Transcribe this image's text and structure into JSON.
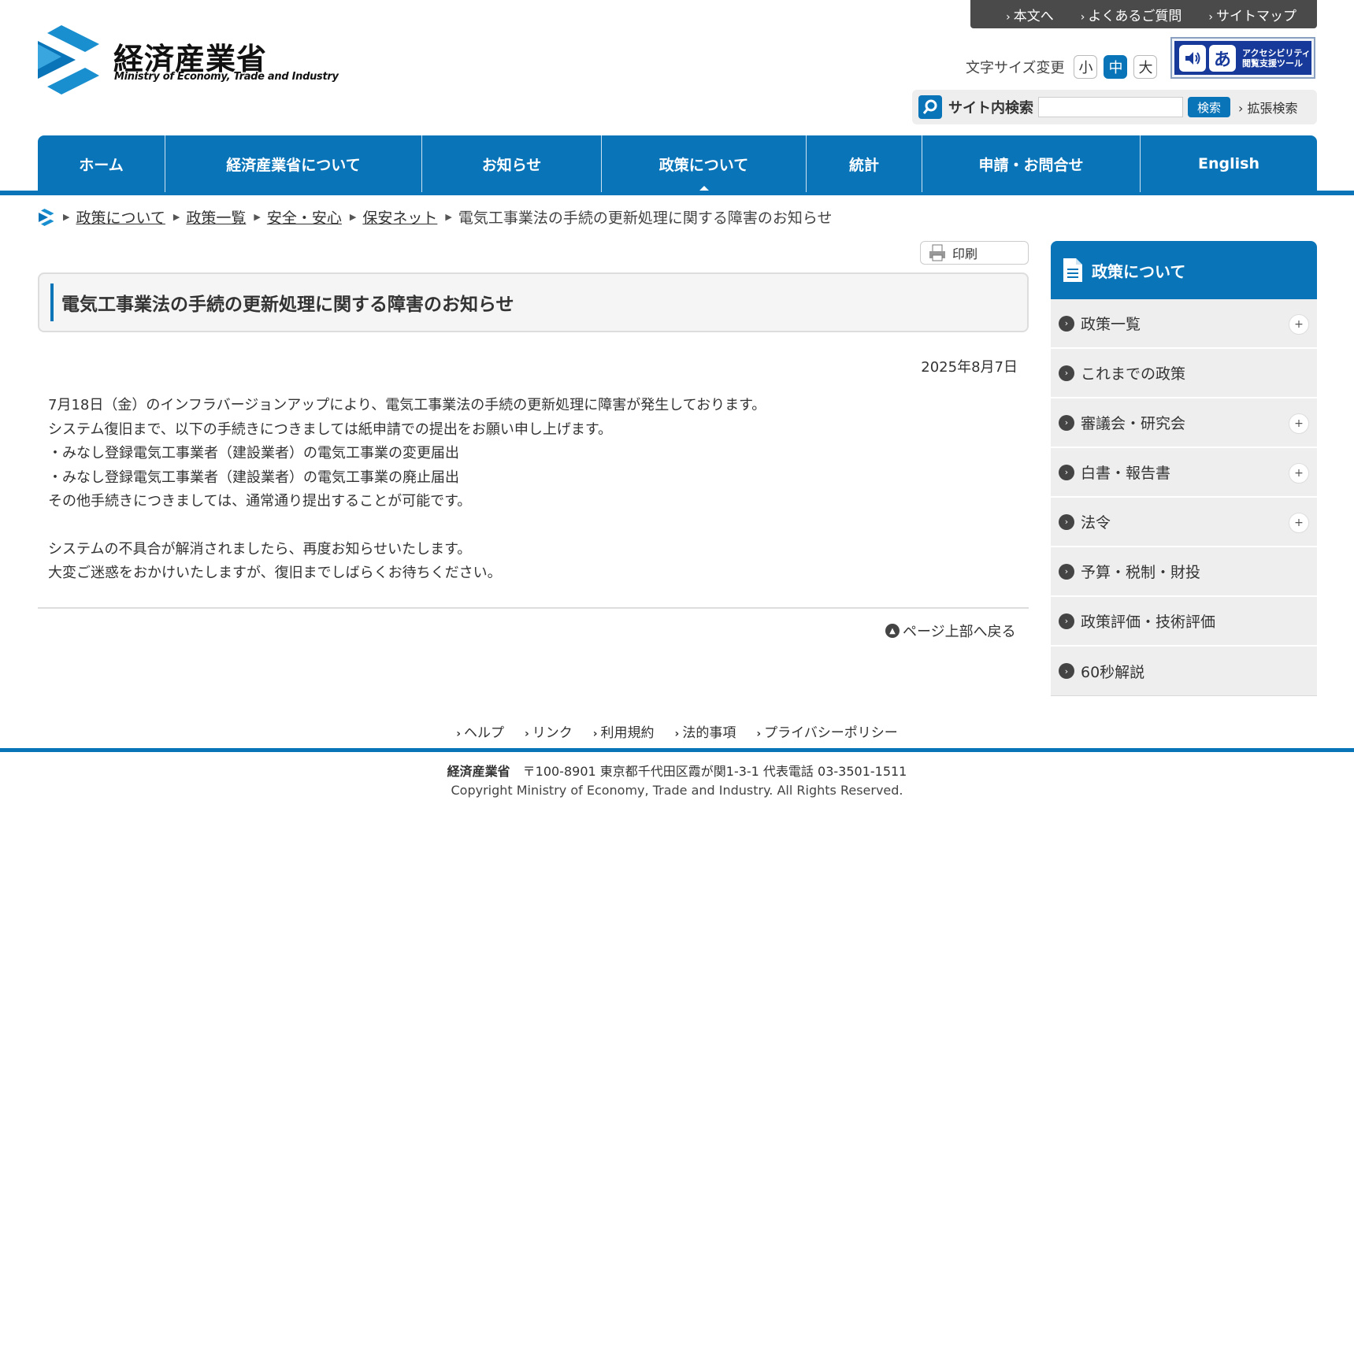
{
  "utility_links": [
    "本文へ",
    "よくあるご質問",
    "サイトマップ"
  ],
  "logo": {
    "name_jp": "経済産業省",
    "name_en": "Ministry of Economy, Trade and Industry"
  },
  "font_size": {
    "label": "文字サイズ変更",
    "options": [
      "小",
      "中",
      "大"
    ],
    "selected": "中"
  },
  "accessibility_tool": {
    "icon_char": "あ",
    "label_line1": "アクセシビリティ",
    "label_line2": "閲覧支援ツール"
  },
  "search": {
    "label": "サイト内検索",
    "value": "",
    "button": "検索",
    "advanced": "拡張検索"
  },
  "global_nav": [
    "ホーム",
    "経済産業省について",
    "お知らせ",
    "政策について",
    "統計",
    "申請・お問合せ",
    "English"
  ],
  "global_nav_current": "政策について",
  "breadcrumb": {
    "links": [
      "政策について",
      "政策一覧",
      "安全・安心",
      "保安ネット"
    ],
    "current": "電気工事業法の手続の更新処理に関する障害のお知らせ"
  },
  "print_label": "印刷",
  "page_title": "電気工事業法の手続の更新処理に関する障害のお知らせ",
  "date": "2025年8月7日",
  "body": [
    "7月18日（金）のインフラバージョンアップにより、電気工事業法の手続の更新処理に障害が発生しております。",
    "システム復旧まで、以下の手続きにつきましては紙申請での提出をお願い申し上げます。",
    "・みなし登録電気工事業者（建設業者）の電気工事業の変更届出",
    "・みなし登録電気工事業者（建設業者）の電気工事業の廃止届出",
    "その他手続きにつきましては、通常通り提出することが可能です。",
    "",
    "システムの不具合が解消されましたら、再度お知らせいたします。",
    "大変ご迷惑をおかけいたしますが、復旧までしばらくお待ちください。"
  ],
  "page_top": "ページ上部へ戻る",
  "sidebar": {
    "title": "政策について",
    "items": [
      {
        "label": "政策一覧",
        "expandable": true
      },
      {
        "label": "これまでの政策",
        "expandable": false
      },
      {
        "label": "審議会・研究会",
        "expandable": true
      },
      {
        "label": "白書・報告書",
        "expandable": true
      },
      {
        "label": "法令",
        "expandable": true
      },
      {
        "label": "予算・税制・財投",
        "expandable": false
      },
      {
        "label": "政策評価・技術評価",
        "expandable": false
      },
      {
        "label": "60秒解説",
        "expandable": false
      }
    ]
  },
  "footer": {
    "links": [
      "ヘルプ",
      "リンク",
      "利用規約",
      "法的事項",
      "プライバシーポリシー"
    ],
    "org": "経済産業省",
    "address": "〒100-8901 東京都千代田区霞が関1-3-1 代表電話 03-3501-1511",
    "copyright": "Copyright Ministry of Economy, Trade and Industry. All Rights Reserved."
  },
  "colors": {
    "brand_blue": "#0a74b8",
    "utility_bar": "#4a4a4a",
    "accessibility_blue": "#17399a"
  }
}
